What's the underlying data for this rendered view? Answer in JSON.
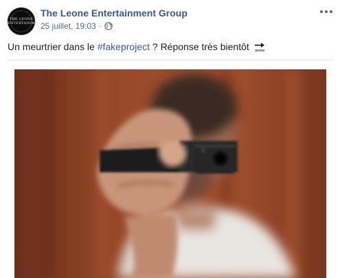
{
  "post": {
    "page_name": "The Leone Entertainment Group",
    "timestamp": "25 juillet, 19:03",
    "separator": "·",
    "privacy_icon": "globe-icon",
    "more_icon": "more-horizontal-icon",
    "avatar_logo_lines": [
      "THE LEONE",
      "ENTERTAINMENT"
    ],
    "text_before": "Un meurtrier dans le ",
    "hashtag": "#fakeproject",
    "text_after": " ? Réponse très bientôt ",
    "emoji": "soon-arrow-emoji",
    "emoji_label": "SOON",
    "photo": "man-pointing-gun-image"
  },
  "colors": {
    "link_blue": "#385898",
    "meta_gray": "#616770",
    "photo_background": "#8a3f22"
  }
}
